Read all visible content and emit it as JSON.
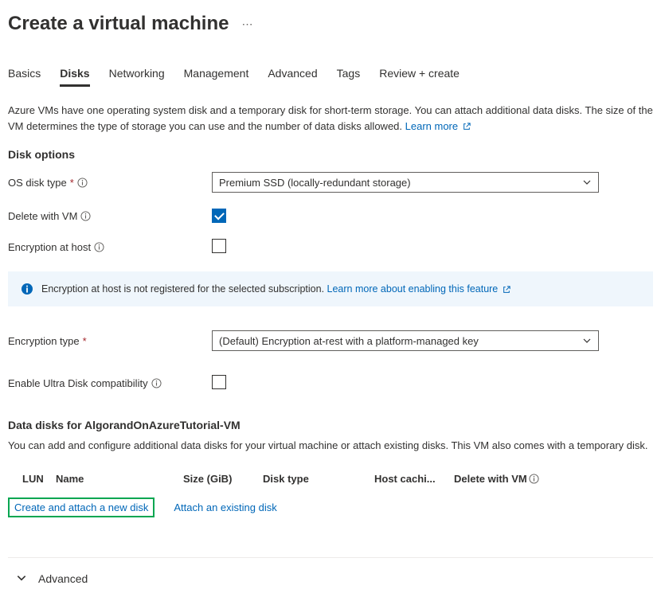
{
  "page": {
    "title": "Create a virtual machine"
  },
  "tabs": [
    "Basics",
    "Disks",
    "Networking",
    "Management",
    "Advanced",
    "Tags",
    "Review + create"
  ],
  "activeTabIndex": 1,
  "description": {
    "text": "Azure VMs have one operating system disk and a temporary disk for short-term storage. You can attach additional data disks. The size of the VM determines the type of storage you can use and the number of data disks allowed. ",
    "learnMore": "Learn more"
  },
  "diskOptions": {
    "heading": "Disk options",
    "osDiskType": {
      "label": "OS disk type",
      "value": "Premium SSD (locally-redundant storage)",
      "required": true
    },
    "deleteWithVm": {
      "label": "Delete with VM",
      "checked": true
    },
    "encryptionAtHost": {
      "label": "Encryption at host",
      "checked": false
    },
    "infoBar": {
      "text": "Encryption at host is not registered for the selected subscription. ",
      "link": "Learn more about enabling this feature"
    },
    "encryptionType": {
      "label": "Encryption type",
      "value": "(Default) Encryption at-rest with a platform-managed key",
      "required": true
    },
    "ultraDisk": {
      "label": "Enable Ultra Disk compatibility",
      "checked": false
    }
  },
  "dataDisks": {
    "heading": "Data disks for AlgorandOnAzureTutorial-VM",
    "description": "You can add and configure additional data disks for your virtual machine or attach existing disks. This VM also comes with a temporary disk.",
    "columns": {
      "lun": "LUN",
      "name": "Name",
      "size": "Size (GiB)",
      "diskType": "Disk type",
      "hostCaching": "Host cachi...",
      "deleteWithVm": "Delete with VM"
    },
    "createAction": "Create and attach a new disk",
    "attachAction": "Attach an existing disk"
  },
  "advanced": {
    "label": "Advanced"
  }
}
